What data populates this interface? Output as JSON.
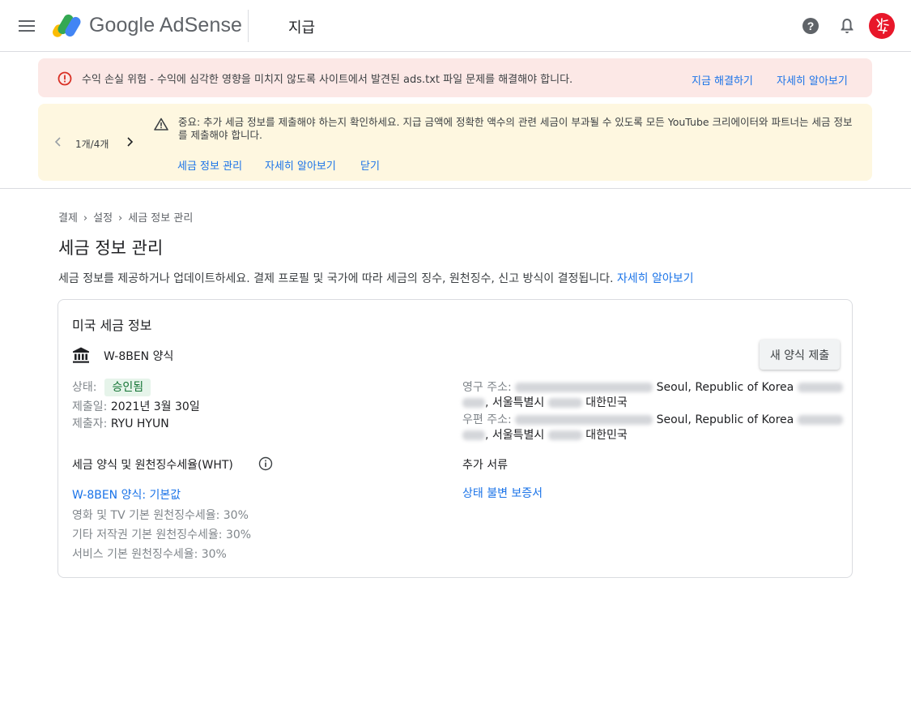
{
  "header": {
    "brand": "Google AdSense",
    "section_title": "지급",
    "icons": [
      "menu-icon",
      "help-icon",
      "notifications-icon",
      "avatar"
    ]
  },
  "error_banner": {
    "message": "수익 손실 위험 - 수익에 심각한 영향을 미치지 않도록 사이트에서 발견된 ads.txt 파일 문제를 해결해야 합니다.",
    "fix_link": "지금 해결하기",
    "learn_link": "자세히 알아보기",
    "color": "#fce8e6"
  },
  "warning_banner": {
    "pager": "1개/4개",
    "message": "중요: 추가 세금 정보를 제출해야 하는지 확인하세요. 지급 금액에 정확한 액수의 관련 세금이 부과될 수 있도록 모든 YouTube 크리에이터와 파트너는 세금 정보를 제출해야 합니다.",
    "manage_link": "세금 정보 관리",
    "learn_link": "자세히 알아보기",
    "close_link": "닫기",
    "color": "#fef7e0"
  },
  "breadcrumb": {
    "items": [
      "결제",
      "설정",
      "세금 정보 관리"
    ]
  },
  "page": {
    "title": "세금 정보 관리",
    "description": "세금 정보를 제공하거나 업데이트하세요. 결제 프로필 및 국가에 따라 세금의 징수, 원천징수, 신고 방식이 결정됩니다.",
    "learn_link": "자세히 알아보기"
  },
  "card": {
    "title": "미국 세금 정보",
    "form_name": "W-8BEN 양식",
    "submit_button": "새 양식 제출",
    "status_label": "상태:",
    "status_value": "승인됨",
    "submitted_date_label": "제출일:",
    "submitted_date": "2021년 3월 30일",
    "submitter_label": "제출자:",
    "submitter": "RYU HYUN",
    "permanent_address_label": "영구 주소:",
    "permanent_address_city": "Seoul, Republic of Korea",
    "permanent_address_line2_sep": ",",
    "permanent_address_region": "서울특별시",
    "permanent_address_country": "대한민국",
    "mailing_address_label": "우편 주소:",
    "mailing_address_city": "Seoul, Republic of Korea",
    "mailing_address_line2_sep": ",",
    "mailing_address_region": "서울특별시",
    "mailing_address_country": "대한민국",
    "wht_heading": "세금 양식 및 원천징수세율(WHT)",
    "additional_docs_heading": "추가 서류",
    "form_default_link": "W-8BEN 양식: 기본값",
    "status_doc_link": "상태 불변 보증서",
    "rates": [
      "영화 및 TV 기본 원천징수세율: 30%",
      "기타 저작권 기본 원천징수세율: 30%",
      "서비스 기본 원천징수세율: 30%"
    ],
    "status_chip_color": "#e6f4ea"
  },
  "colors": {
    "link": "#1a73e8",
    "text": "#202124",
    "muted": "#80868b",
    "avatar": "#e8172a"
  }
}
